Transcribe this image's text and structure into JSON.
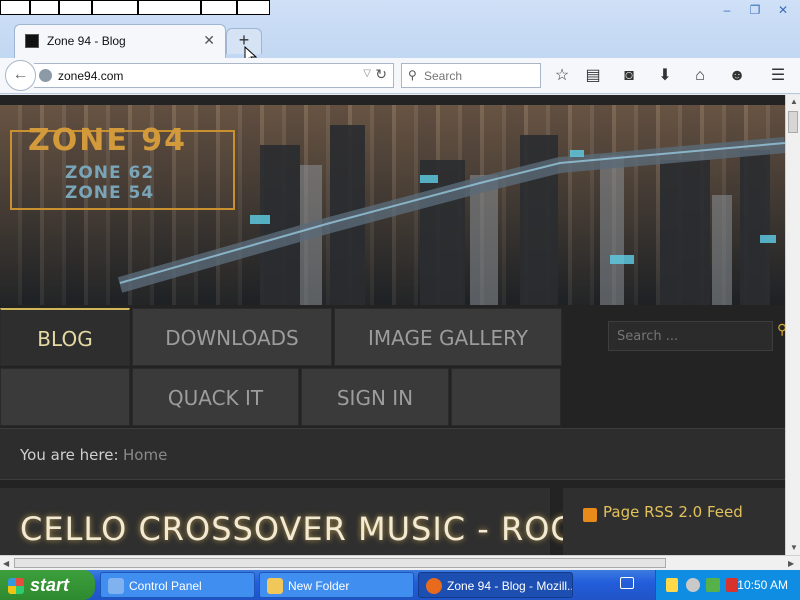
{
  "browser": {
    "tab_title": "Zone 94 - Blog",
    "tab_close": "✕",
    "new_tab": "+",
    "url": "zone94.com",
    "search_placeholder": "Search",
    "window_controls": [
      "–",
      "❐",
      "✕"
    ]
  },
  "toolbar_icons": [
    "star-icon",
    "clipboard-icon",
    "pocket-icon",
    "download-icon",
    "home-icon",
    "chat-icon",
    "menu-icon"
  ],
  "site": {
    "logo": {
      "main": "ZONE 94",
      "sub1": "ZONE 62",
      "sub2": "ZONE 54"
    },
    "nav": {
      "row1": [
        "BLOG",
        "DOWNLOADS",
        "IMAGE GALLERY"
      ],
      "row2": [
        "QUACK IT",
        "SIGN IN"
      ],
      "search_placeholder": "Search ..."
    },
    "breadcrumb": {
      "label": "You are here:",
      "home": "Home"
    },
    "article": {
      "title": "CELLO CROSSOVER MUSIC - ROCK AND"
    },
    "sidebar": {
      "rss": "Page RSS 2.0 Feed"
    }
  },
  "taskbar": {
    "start": "start",
    "items": [
      "Control Panel",
      "New Folder",
      "Zone 94 - Blog - Mozill..."
    ],
    "clock": "10:50 AM"
  },
  "colors": {
    "accent": "#d2b65a",
    "page_bg": "#232323",
    "taskbar": "#245edb"
  }
}
